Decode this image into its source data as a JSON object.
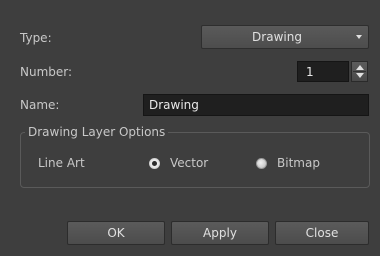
{
  "form": {
    "type_label": "Type:",
    "type_value": "Drawing",
    "number_label": "Number:",
    "number_value": "1",
    "name_label": "Name:",
    "name_value": "Drawing"
  },
  "options": {
    "group_title": "Drawing Layer Options",
    "line_art_label": "Line Art",
    "vector_label": "Vector",
    "bitmap_label": "Bitmap",
    "selected": "Vector"
  },
  "buttons": {
    "ok": "OK",
    "apply": "Apply",
    "close": "Close"
  }
}
